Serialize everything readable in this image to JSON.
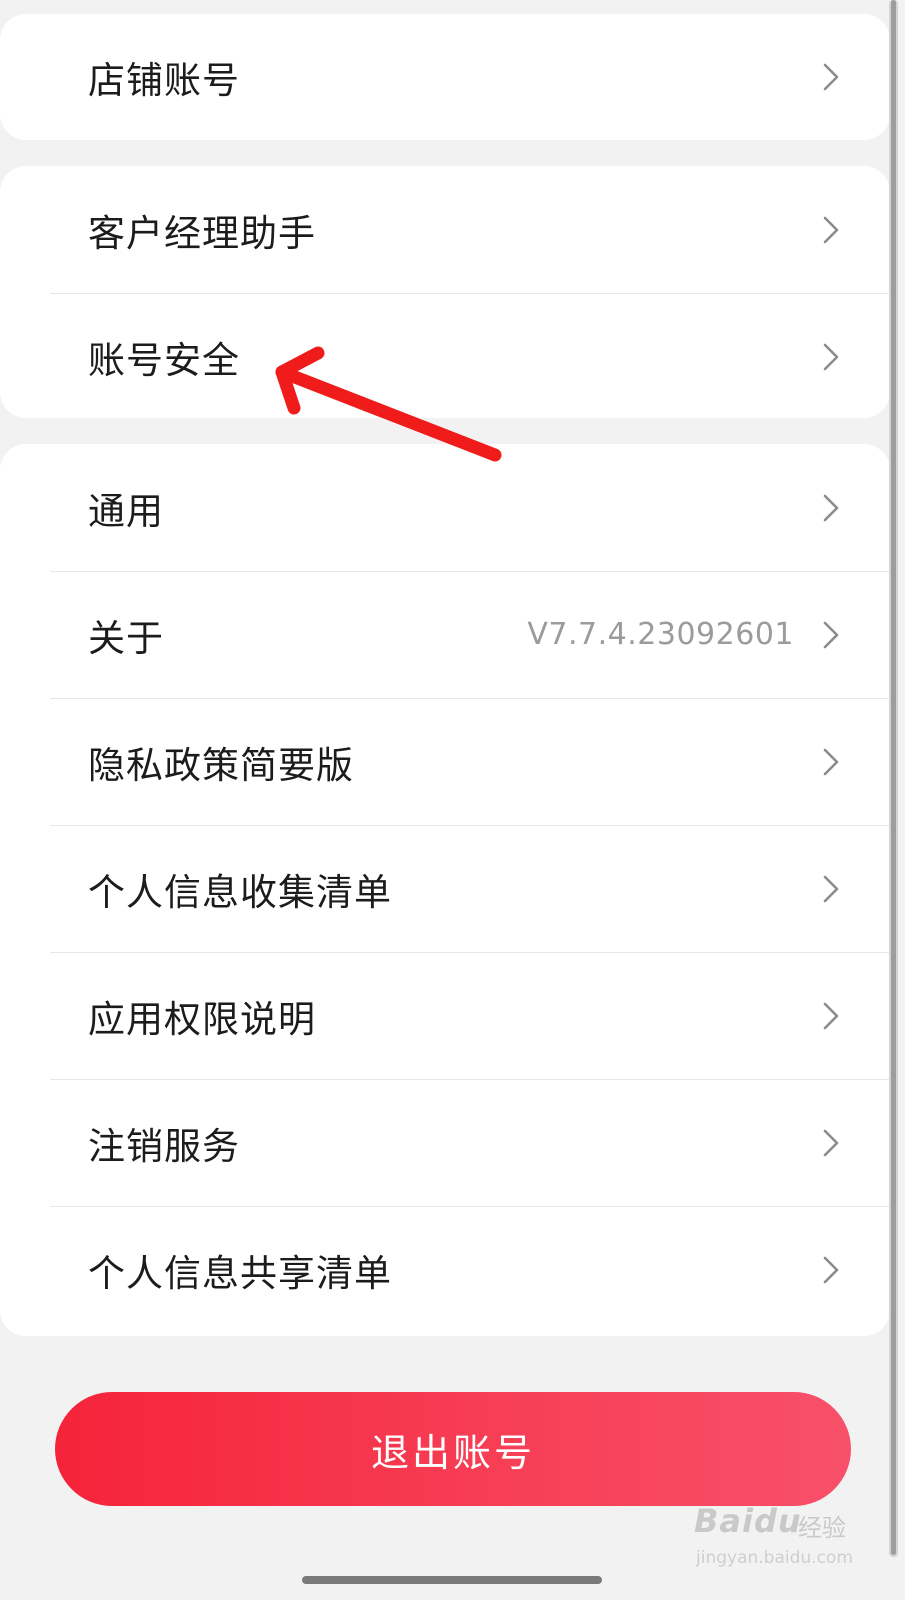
{
  "sections": [
    {
      "items": [
        {
          "label": "店铺账号"
        }
      ]
    },
    {
      "items": [
        {
          "label": "客户经理助手"
        },
        {
          "label": "账号安全"
        }
      ]
    },
    {
      "items": [
        {
          "label": "通用"
        },
        {
          "label": "关于",
          "value": "V7.7.4.23092601"
        },
        {
          "label": "隐私政策简要版"
        },
        {
          "label": "个人信息收集清单"
        },
        {
          "label": "应用权限说明"
        },
        {
          "label": "注销服务"
        },
        {
          "label": "个人信息共享清单"
        }
      ]
    }
  ],
  "logout": {
    "label": "退出账号"
  },
  "watermark": {
    "brand": "Baidu",
    "sub": "经验",
    "url": "jingyan.baidu.com"
  },
  "colors": {
    "accent_start": "#f5233a",
    "accent_end": "#f8506a",
    "annotation_arrow": "#f01c1c",
    "background": "#f2f2f2"
  },
  "icons": {
    "row_chevron": "chevron-right-icon"
  }
}
